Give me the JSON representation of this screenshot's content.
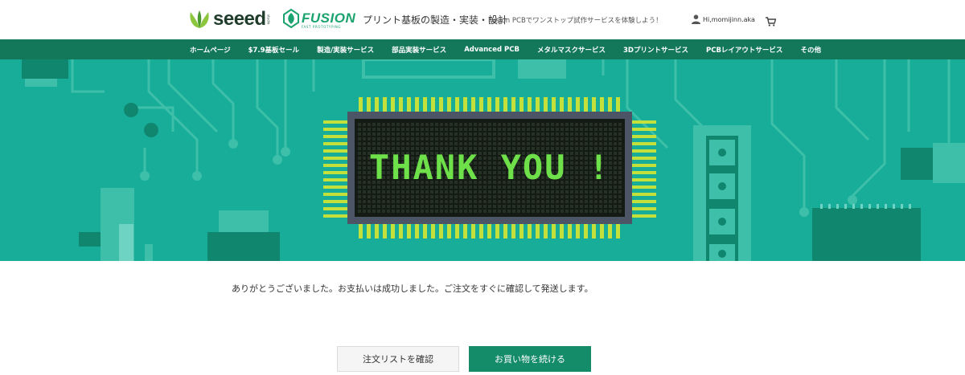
{
  "header": {
    "seeed_logo_text": "seeed",
    "seeed_logo_sub": "studio",
    "fusion_logo_text": "FUSION",
    "fusion_logo_tagline": "FAST PROTOTYPING",
    "title": "プリント基板の製造・実装・設計",
    "subtitle": "Fusion PCBでワンストップ試作サービスを体験しよう！",
    "user_greeting": "Hi,momijinn.aka"
  },
  "nav": {
    "items": [
      {
        "label": "ホームページ"
      },
      {
        "label": "$7.9基板セール"
      },
      {
        "label": "製造/実装サービス"
      },
      {
        "label": "部品実装サービス"
      },
      {
        "label": "Advanced PCB"
      },
      {
        "label": "メタルマスクサービス"
      },
      {
        "label": "3Dプリントサービス"
      },
      {
        "label": "PCBレイアウトサービス"
      },
      {
        "label": "その他"
      }
    ]
  },
  "banner": {
    "text": "THANK YOU !",
    "text_color": "#6ee04a",
    "background_color": "#18ad98"
  },
  "message": "ありがとうございました。お支払いは成功しました。ご注文をすぐに確認して発送します。",
  "buttons": {
    "orders_label": "注文リストを確認",
    "continue_label": "お買い物を続ける"
  },
  "colors": {
    "nav_bg": "#13785a",
    "accent": "#148b69"
  }
}
